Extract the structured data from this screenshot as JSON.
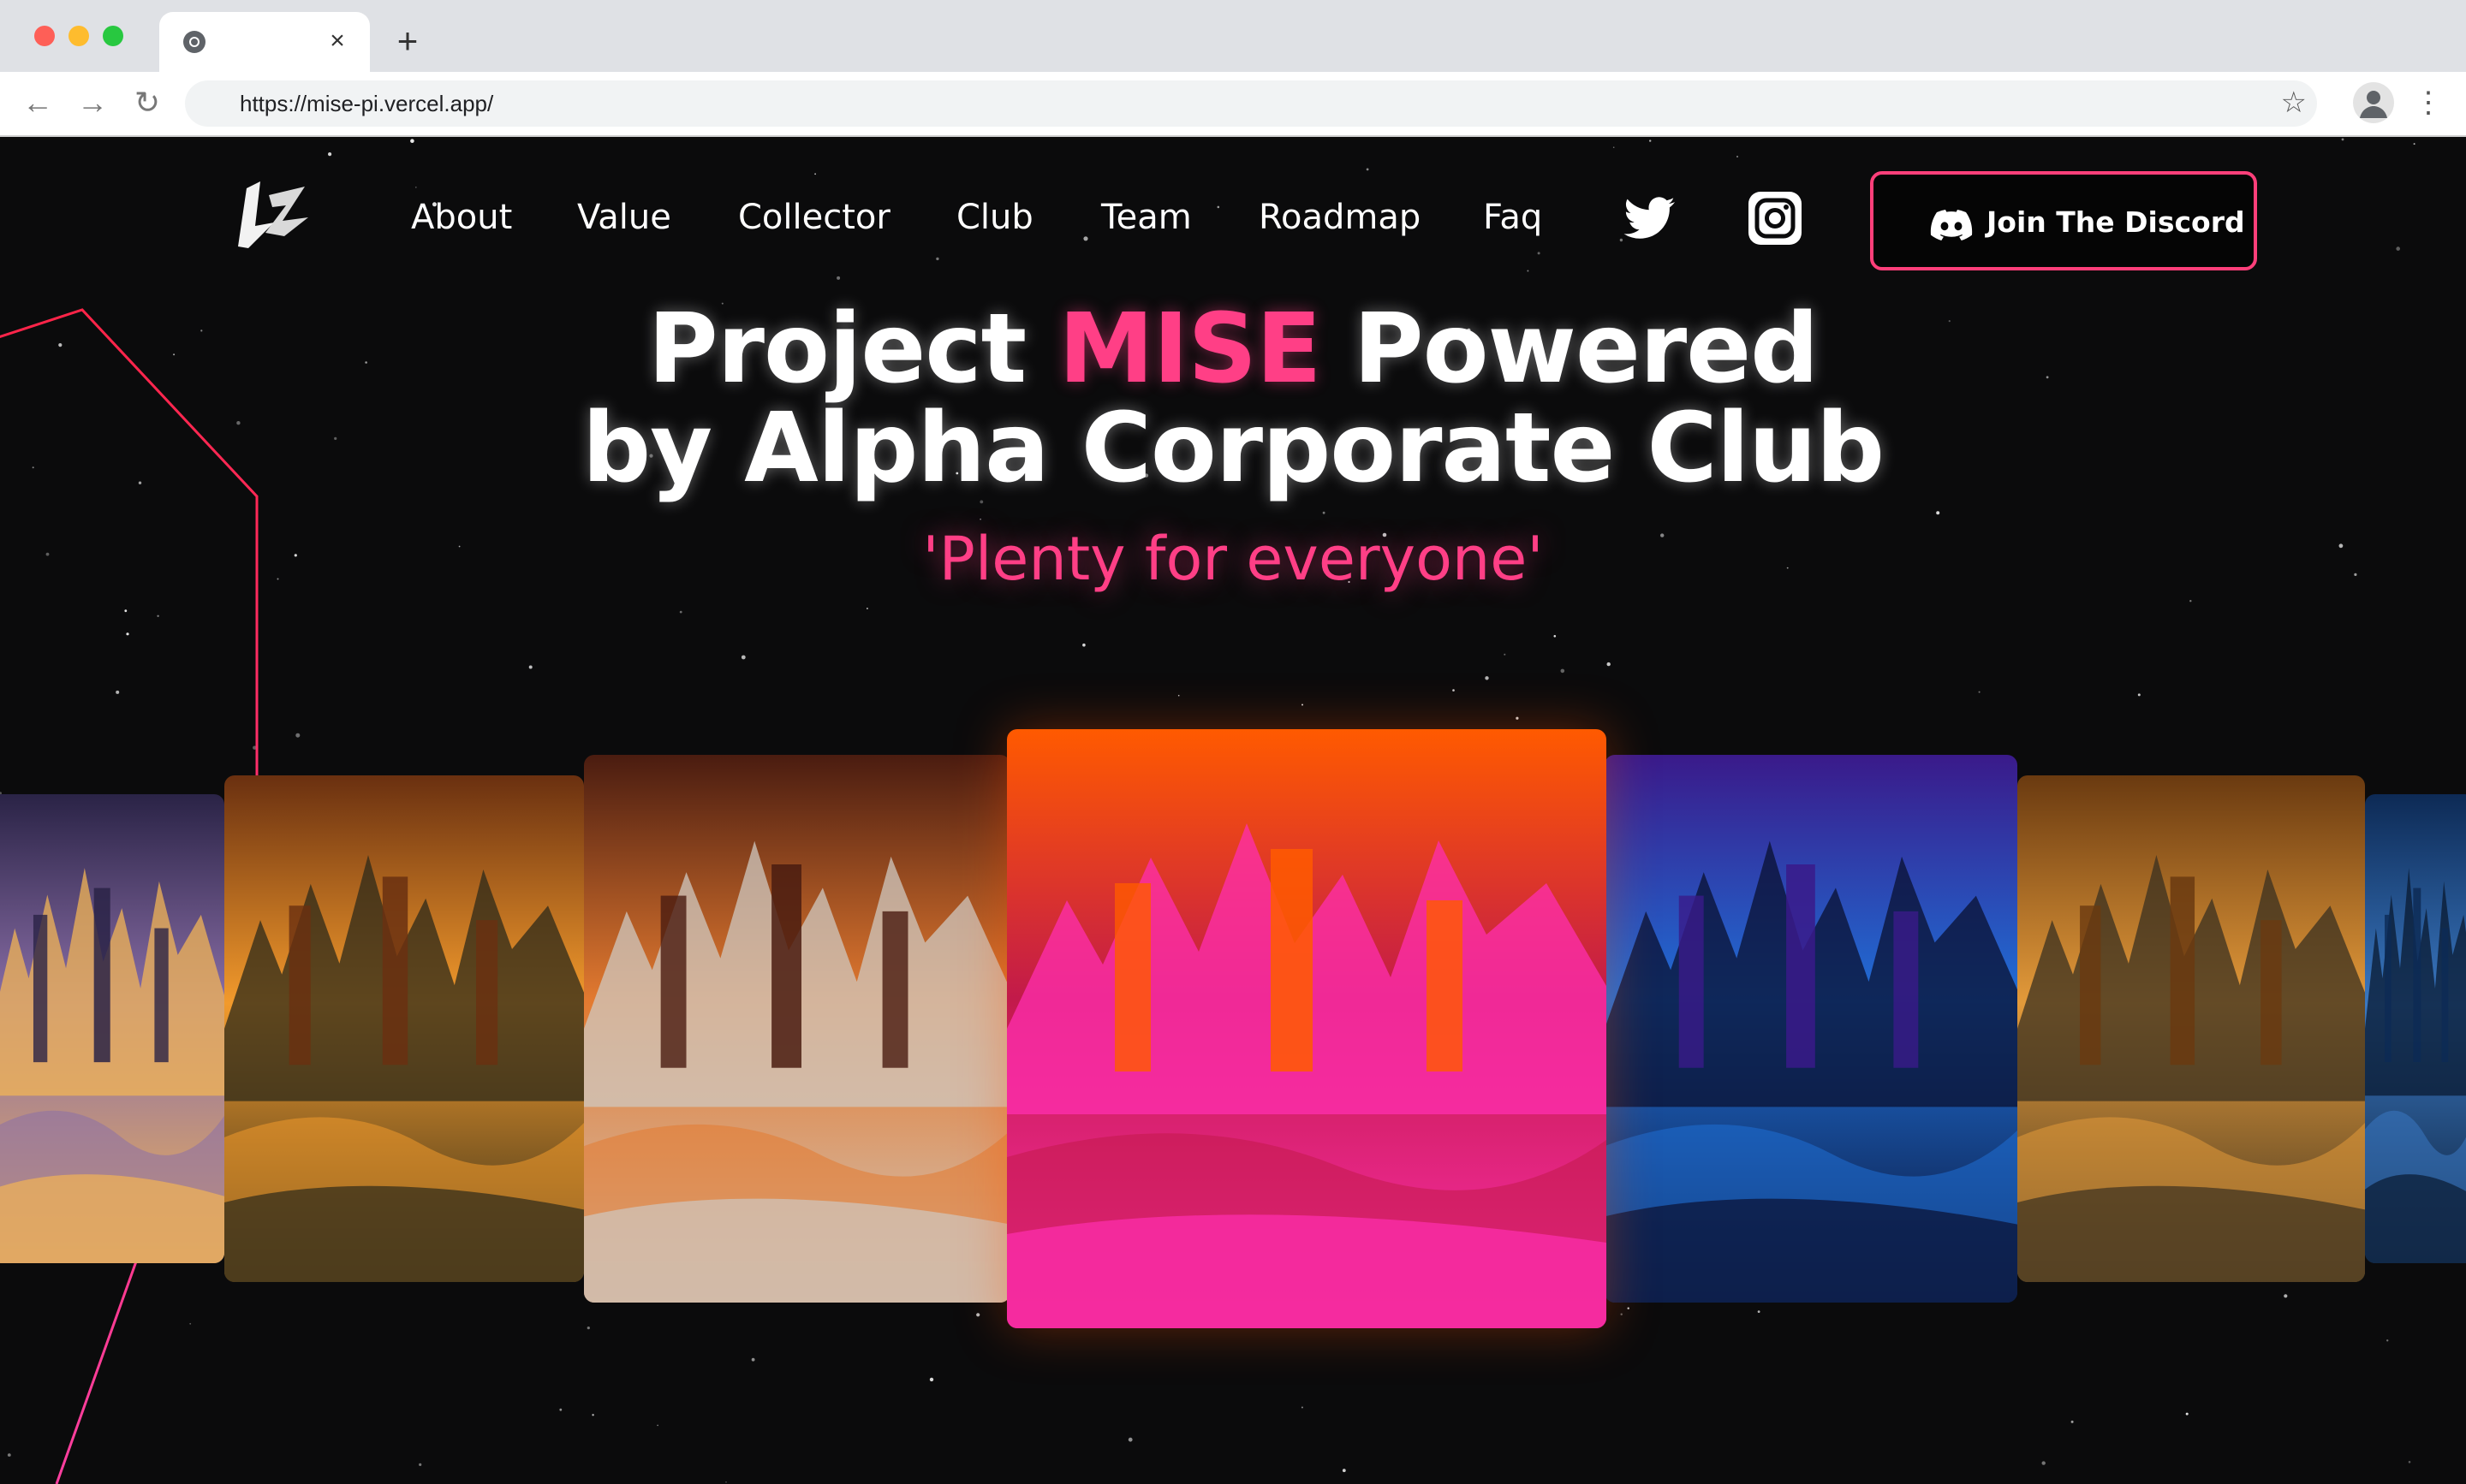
{
  "browser": {
    "url": "https://mise-pi.vercel.app/",
    "tab_close": "×",
    "new_tab": "+",
    "back": "←",
    "forward": "→",
    "reload": "↻",
    "bookmark": "☆",
    "menu": "⋮"
  },
  "nav": {
    "items": [
      {
        "label": "About"
      },
      {
        "label": "Value"
      },
      {
        "label": "Collector"
      },
      {
        "label": "Club"
      },
      {
        "label": "Team"
      },
      {
        "label": "Roadmap"
      },
      {
        "label": "Faq"
      }
    ],
    "social": [
      "twitter-icon",
      "instagram-icon"
    ],
    "cta_label": "Join The Discord"
  },
  "hero": {
    "line1_prefix": "Project ",
    "line1_accent": "MISE",
    "line1_suffix": " Powered",
    "line2": "by Alpha Corporate Club",
    "tagline": "'Plenty for everyone'"
  },
  "colors": {
    "accent": "#ff3f86",
    "background": "#0b0b0c",
    "button_border": "#ff3f7a"
  },
  "gallery": {
    "cards": [
      {
        "name": "night-city-mountains",
        "palette": [
          "#2a2346",
          "#8b6fa8",
          "#f2b455"
        ]
      },
      {
        "name": "sunset-city-tree",
        "palette": [
          "#6a3010",
          "#f29a2c",
          "#2c2a1a"
        ]
      },
      {
        "name": "dubai-waterfall",
        "palette": [
          "#4a1c10",
          "#e37a30",
          "#cfc8c0"
        ]
      },
      {
        "name": "moulin-rouge-lion",
        "palette": [
          "#ff5a00",
          "#c21a4a",
          "#ff2fb0"
        ]
      },
      {
        "name": "singapore-purple",
        "palette": [
          "#3a1a8a",
          "#1f6fd6",
          "#0a1030"
        ]
      },
      {
        "name": "desert-road-city",
        "palette": [
          "#6a3a10",
          "#e39a3a",
          "#3a3020"
        ]
      },
      {
        "name": "blue-storm-edge",
        "palette": [
          "#0d2a55",
          "#3a78c2",
          "#0a1a30"
        ]
      }
    ]
  }
}
